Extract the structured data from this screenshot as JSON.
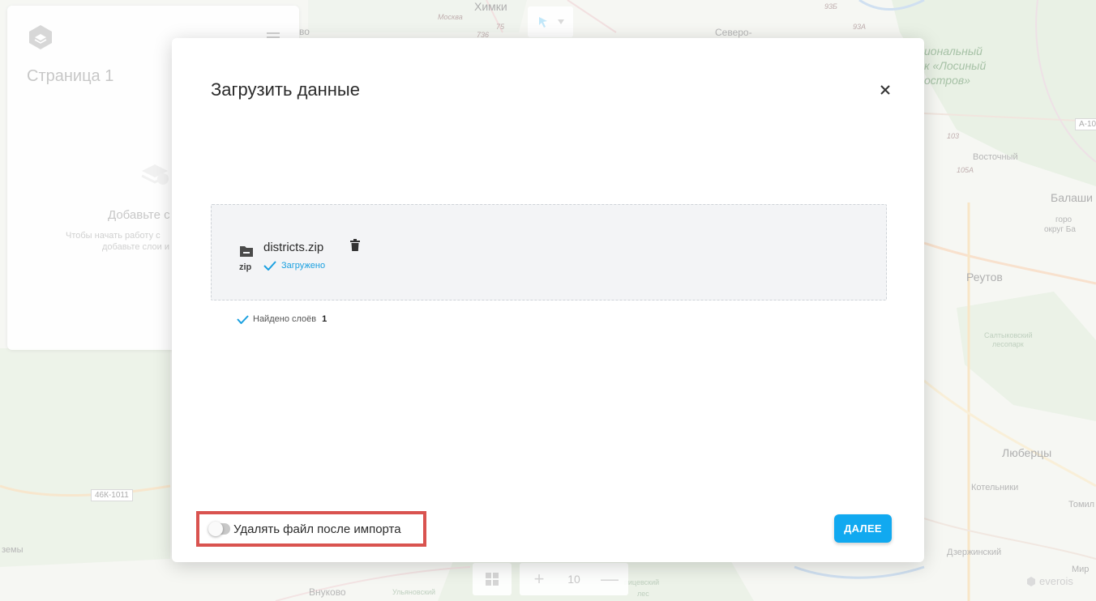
{
  "map": {
    "labels": {
      "khimki": "Химки",
      "severo": "Северо-",
      "vo": "во",
      "park_1": "иональный",
      "park_2": "к «Лосиный",
      "park_3": "остров»",
      "vostochny": "Восточный",
      "balashi": "Балаши",
      "gorod": "горо",
      "okrug": "округ Ба",
      "reutov": "Реутов",
      "saltykovsky_1": "Салтыковский",
      "saltykovsky_2": "лесопарк",
      "lyubertsy": "Люберцы",
      "kotelniki": "Котельники",
      "tomil": "Томил",
      "dzerzhinsky": "Дзержинский",
      "miri": "Мир",
      "vnukovo": "Внуково",
      "ulyanovsky": "Ульяновский",
      "les": "лес",
      "zemy": "земы",
      "moskva_road": "Москва",
      "tsevsky": "пицевский"
    },
    "road_badges": {
      "r46k": "46К-1011",
      "ra10": "А-10",
      "r93b": "93Б",
      "r93a": "93А",
      "r736": "736",
      "r75": "75",
      "r103": "103",
      "r105a": "105А"
    }
  },
  "page_panel": {
    "title": "Страница 1",
    "empty_title": "Добавьте с",
    "empty_hint_line1": "Чтобы начать работу с",
    "empty_hint_line2": "добавьте слои и"
  },
  "zoom": {
    "level": "10",
    "plus": "+",
    "minus": "—"
  },
  "brand": {
    "name": "everois"
  },
  "modal": {
    "title": "Загрузить данные",
    "file": {
      "name": "districts.zip",
      "extension": "zip",
      "status": "Загружено"
    },
    "layers_found_label": "Найдено слоёв",
    "layers_found_count": "1",
    "delete_after_import_label": "Удалять файл после импорта",
    "delete_after_import_enabled": false,
    "next_button": "ДАЛЕЕ"
  },
  "colors": {
    "accent": "#11a9f0",
    "status_blue": "#1aa0e0",
    "highlight_border": "#d9534f"
  }
}
